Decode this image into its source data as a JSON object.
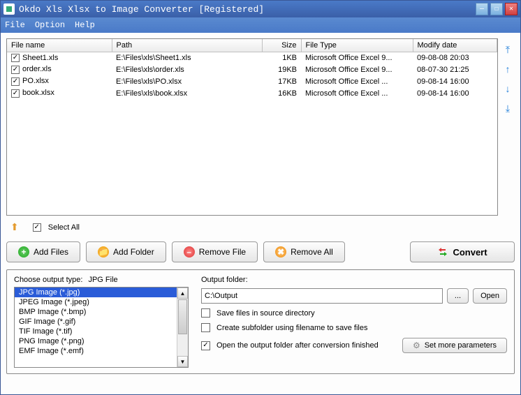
{
  "window": {
    "title": "Okdo Xls Xlsx to Image Converter [Registered]"
  },
  "menu": {
    "file": "File",
    "option": "Option",
    "help": "Help"
  },
  "table": {
    "headers": {
      "name": "File name",
      "path": "Path",
      "size": "Size",
      "type": "File Type",
      "date": "Modify date"
    },
    "rows": [
      {
        "checked": true,
        "name": "Sheet1.xls",
        "path": "E:\\Files\\xls\\Sheet1.xls",
        "size": "1KB",
        "type": "Microsoft Office Excel 9...",
        "date": "09-08-08 20:03"
      },
      {
        "checked": true,
        "name": "order.xls",
        "path": "E:\\Files\\xls\\order.xls",
        "size": "19KB",
        "type": "Microsoft Office Excel 9...",
        "date": "08-07-30 21:25"
      },
      {
        "checked": true,
        "name": "PO.xlsx",
        "path": "E:\\Files\\xls\\PO.xlsx",
        "size": "17KB",
        "type": "Microsoft Office Excel ...",
        "date": "09-08-14 16:00"
      },
      {
        "checked": true,
        "name": "book.xlsx",
        "path": "E:\\Files\\xls\\book.xlsx",
        "size": "16KB",
        "type": "Microsoft Office Excel ...",
        "date": "09-08-14 16:00"
      }
    ]
  },
  "selectAll": {
    "label": "Select All",
    "checked": true
  },
  "buttons": {
    "addFiles": "Add Files",
    "addFolder": "Add Folder",
    "removeFile": "Remove File",
    "removeAll": "Remove All",
    "convert": "Convert"
  },
  "output": {
    "typeLabel": "Choose output type:",
    "typeValue": "JPG File",
    "list": [
      "JPG Image (*.jpg)",
      "JPEG Image (*.jpeg)",
      "BMP Image (*.bmp)",
      "GIF Image (*.gif)",
      "TIF Image (*.tif)",
      "PNG Image (*.png)",
      "EMF Image (*.emf)"
    ],
    "selectedIndex": 0,
    "folderLabel": "Output folder:",
    "folderValue": "C:\\Output",
    "browse": "...",
    "open": "Open",
    "opt1": {
      "label": "Save files in source directory",
      "checked": false
    },
    "opt2": {
      "label": "Create subfolder using filename to save files",
      "checked": false
    },
    "opt3": {
      "label": "Open the output folder after conversion finished",
      "checked": true
    },
    "moreParams": "Set more parameters"
  }
}
